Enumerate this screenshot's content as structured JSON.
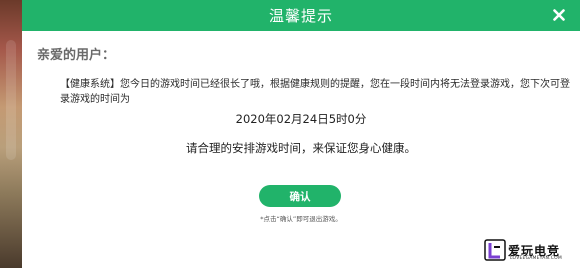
{
  "dialog": {
    "title": "温馨提示",
    "greeting": "亲爱的用户：",
    "message": "【健康系统】您今日的游戏时间已经很长了哦，根据健康规则的提醒，您在一段时间内将无法登录游戏，您下次可登录游戏的时间为",
    "datetime": "2020年02月24日5时0分",
    "advice": "请合理的安排游戏时间，来保证您身心健康。",
    "confirm_label": "确认",
    "hint": "*点击“确认”即可退出游戏。"
  },
  "watermark": {
    "text": "爱玩电竞",
    "domain": "LOVEEGAMEYAN.COM"
  },
  "colors": {
    "header": "#21b36a",
    "button": "#21b36a",
    "background": "#e9e9e9"
  },
  "icons": {
    "close": "close-icon",
    "logo": "logo-icon"
  }
}
